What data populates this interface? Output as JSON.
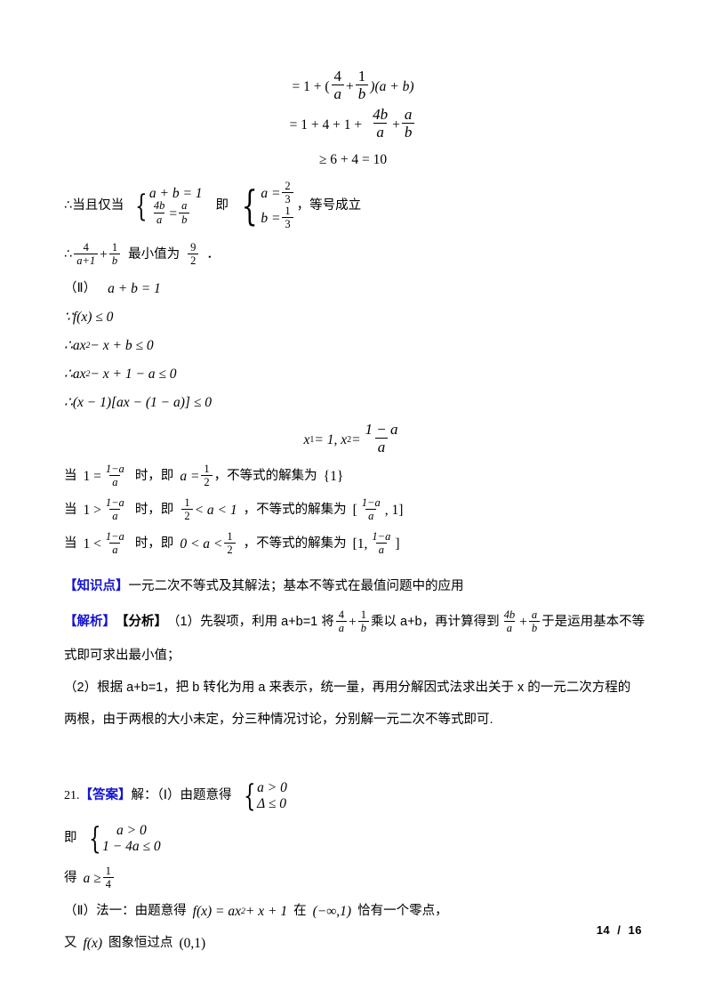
{
  "page": {
    "footer_page": "14",
    "footer_sep": "/",
    "footer_total": "16",
    "accent_blue": "#1414d2",
    "text_color": "#000000",
    "background": "#ffffff"
  },
  "derivation": {
    "line1_eq": "= 1 + (",
    "line1_frac1_n": "4",
    "line1_frac1_d": "a",
    "line1_plus": "+",
    "line1_frac2_n": "1",
    "line1_frac2_d": "b",
    "line1_tail": ")(a + b)",
    "line2_eq": "= 1 + 4 + 1 +",
    "line2_frac1_n": "4b",
    "line2_frac1_d": "a",
    "line2_plus": "+",
    "line2_frac2_n": "a",
    "line2_frac2_d": "b",
    "line3": "≥ 6 + 4 = 10"
  },
  "equality_case": {
    "therefore_prefix": "∴当且仅当",
    "cond_row1": "a + b = 1",
    "cond_row2_frac_n": "4b",
    "cond_row2_frac_d": "a",
    "cond_row2_eq": "=",
    "cond_row2_frac2_n": "a",
    "cond_row2_frac2_d": "b",
    "ji": "即",
    "res_row1_var": "a =",
    "res_row1_n": "2",
    "res_row1_d": "3",
    "res_row2_var": "b =",
    "res_row2_n": "1",
    "res_row2_d": "3",
    "suffix": "，等号成立"
  },
  "min_value_line": {
    "prefix": "∴",
    "frac1_n": "4",
    "frac1_d": "a+1",
    "plus": "+",
    "frac2_n": "1",
    "frac2_d": "b",
    "label": "最小值为",
    "val_n": "9",
    "val_d": "2",
    "period": "．"
  },
  "part_two": {
    "heading_label": "（Ⅱ）",
    "heading_eq": "a + b = 1",
    "step1": "∵f(x) ≤ 0",
    "step2_prefix": "∴ax",
    "step2_exp": "2",
    "step2_rest": " − x + b ≤ 0",
    "step3_prefix": "∴ax",
    "step3_exp": "2",
    "step3_rest": " − x + 1 − a ≤ 0",
    "step4": "∴(x − 1)[ax − (1 − a)] ≤ 0",
    "roots_prefix": "x",
    "roots_sub1": "1",
    "roots_mid": " = 1, x",
    "roots_sub2": "2",
    "roots_eq": " =",
    "roots_frac_n": "1 − a",
    "roots_frac_d": "a"
  },
  "cases": [
    {
      "dang": "当",
      "lhs": "1 =",
      "frac_n": "1−a",
      "frac_d": "a",
      "shi": "时，即",
      "cond_var": "a =",
      "cond_n": "1",
      "cond_d": "2",
      "comma": "，",
      "label": "不等式的解集为",
      "set_plain": "{1}",
      "set_type": "plain"
    },
    {
      "dang": "当",
      "lhs": "1 >",
      "frac_n": "1−a",
      "frac_d": "a",
      "shi": "时，即",
      "cond_pre_n": "1",
      "cond_pre_d": "2",
      "cond_tail": "< a < 1",
      "comma": "，",
      "label": "不等式的解集为",
      "set_open": "[",
      "set_frac_n": "1−a",
      "set_frac_d": "a",
      "set_tail": ", 1]",
      "set_type": "frac-first"
    },
    {
      "dang": "当",
      "lhs": "1 <",
      "frac_n": "1−a",
      "frac_d": "a",
      "shi": "时，即",
      "cond_pre": "0 < a <",
      "cond_n": "1",
      "cond_d": "2",
      "comma": "，",
      "label": "不等式的解集为",
      "set_open": "[1,",
      "set_frac_n": "1−a",
      "set_frac_d": "a",
      "set_tail": "]",
      "set_type": "frac-second"
    }
  ],
  "knowledge": {
    "tag": "【知识点】",
    "text": "一元二次不等式及其解法；基本不等式在最值问题中的应用"
  },
  "analysis": {
    "tag_blue": "【解析】",
    "tag_black": "【分析】",
    "seg1": "（1）先裂项，利用 a+b=1 将",
    "frac1_n": "4",
    "frac1_d": "a",
    "plus": "+",
    "frac2_n": "1",
    "frac2_d": "b",
    "seg2": "乘以 a+b，再计算得到",
    "frac3_n": "4b",
    "frac3_d": "a",
    "plus2": "+",
    "frac4_n": "a",
    "frac4_d": "b",
    "seg3": "于是运用基本不等",
    "line2": "式即可求出最小值；",
    "line3": "（2）根据 a+b=1，把 b 转化为用 a 来表示，统一量，再用分解因式法求出关于 x 的一元二次方程的",
    "line4": "两根，由于两根的大小未定，分三种情况讨论，分别解一元二次不等式即可."
  },
  "question21": {
    "number": "21.",
    "tag": "【答案】",
    "solve": "解：（Ⅰ）由题意得",
    "sys1_row1": "a > 0",
    "sys1_row2": "Δ ≤ 0",
    "ji": "即",
    "sys2_row1": "a > 0",
    "sys2_row2": "1 − 4a ≤ 0",
    "de": "得",
    "result_var": "a ≥",
    "result_n": "1",
    "result_d": "4",
    "part2_line1_pre": "（Ⅱ）法一：由题意得",
    "part2_fx": "f(x) = ax",
    "part2_exp": "2",
    "part2_fx_tail": " + x + 1",
    "part2_zai": "在",
    "part2_interval": "(−∞,1)",
    "part2_tail": "恰有一个零点，",
    "part2_line2_pre": "又",
    "part2_line2_fx": "f(x)",
    "part2_line2_mid": "图象恒过点",
    "part2_line2_pt": "(0,1)"
  }
}
